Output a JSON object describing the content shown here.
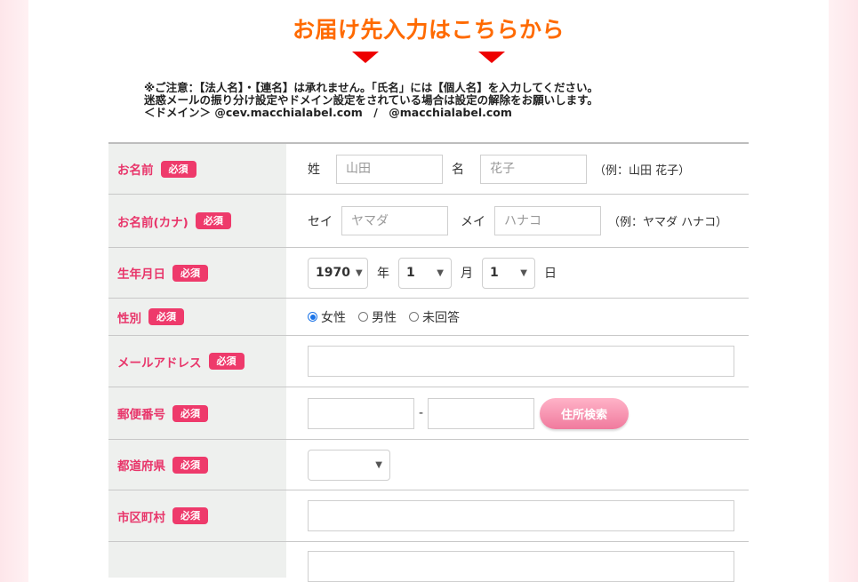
{
  "header": {
    "title": "お届け先入力はこちらから"
  },
  "notice": {
    "line1": "※ご注意：【法人名】・【連名】は承れません。「氏名」には【個人名】を入力してください。",
    "line2": "迷惑メールの振り分け設定やドメイン設定をされている場合は設定の解除をお願いします。",
    "line3": "＜ドメイン＞ @cev.macchialabel.com　/　@macchialabel.com"
  },
  "required_badge": "必須",
  "form": {
    "name": {
      "label": "お名前",
      "last_label": "姓",
      "last_placeholder": "山田",
      "first_label": "名",
      "first_placeholder": "花子",
      "example": "（例：山田 花子）"
    },
    "kana": {
      "label": "お名前(カナ)",
      "last_label": "セイ",
      "last_placeholder": "ヤマダ",
      "first_label": "メイ",
      "first_placeholder": "ハナコ",
      "example": "（例：ヤマダ ハナコ）"
    },
    "birthday": {
      "label": "生年月日",
      "year_value": "1970",
      "year_unit": "年",
      "month_value": "1",
      "month_unit": "月",
      "day_value": "1",
      "day_unit": "日"
    },
    "gender": {
      "label": "性別",
      "options": [
        "女性",
        "男性",
        "未回答"
      ],
      "selected": "女性"
    },
    "email": {
      "label": "メールアドレス",
      "value": ""
    },
    "zip": {
      "label": "郵便番号",
      "separator": "-",
      "search_button": "住所検索"
    },
    "prefecture": {
      "label": "都道府県",
      "value": ""
    },
    "city": {
      "label": "市区町村",
      "value": ""
    }
  },
  "colors": {
    "heading": "#ff6a00",
    "label": "#e8356a",
    "badge": "#ee3a6b",
    "arrow": "#ee0000"
  }
}
